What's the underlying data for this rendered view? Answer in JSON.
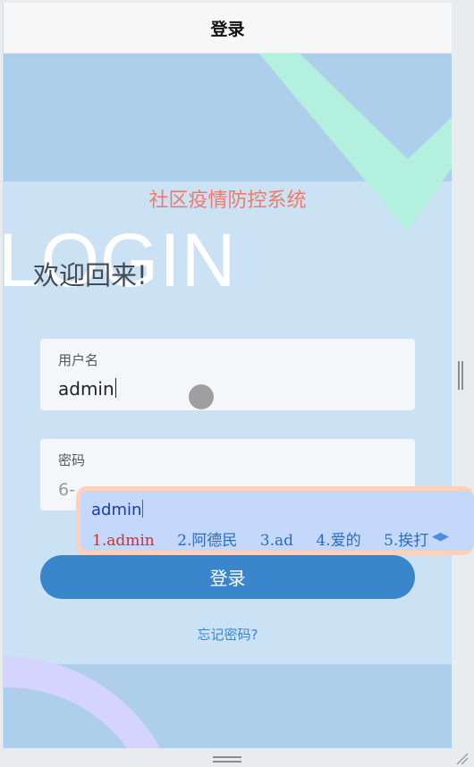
{
  "window": {
    "title": "登录"
  },
  "app": {
    "system_title": "社区疫情防控系统",
    "login_watermark": "LOGIN",
    "welcome": "欢迎回来!"
  },
  "form": {
    "username": {
      "label": "用户名",
      "value": "admin"
    },
    "password": {
      "label": "密码",
      "placeholder_visible": "6-"
    },
    "login_button": "登录",
    "forgot_link": "忘记密码?"
  },
  "ime": {
    "composition": "admin",
    "candidates": [
      "1.admin",
      "2.阿德民",
      "3.ad",
      "4.爱的",
      "5.挨打"
    ],
    "selected_index": 0,
    "nav_arrows": "◀▶"
  },
  "colors": {
    "accent": "#3a86cc",
    "system_title": "#f07a6a",
    "deco_mint": "#b3f0de",
    "deco_lavender": "#d5d4ff"
  }
}
